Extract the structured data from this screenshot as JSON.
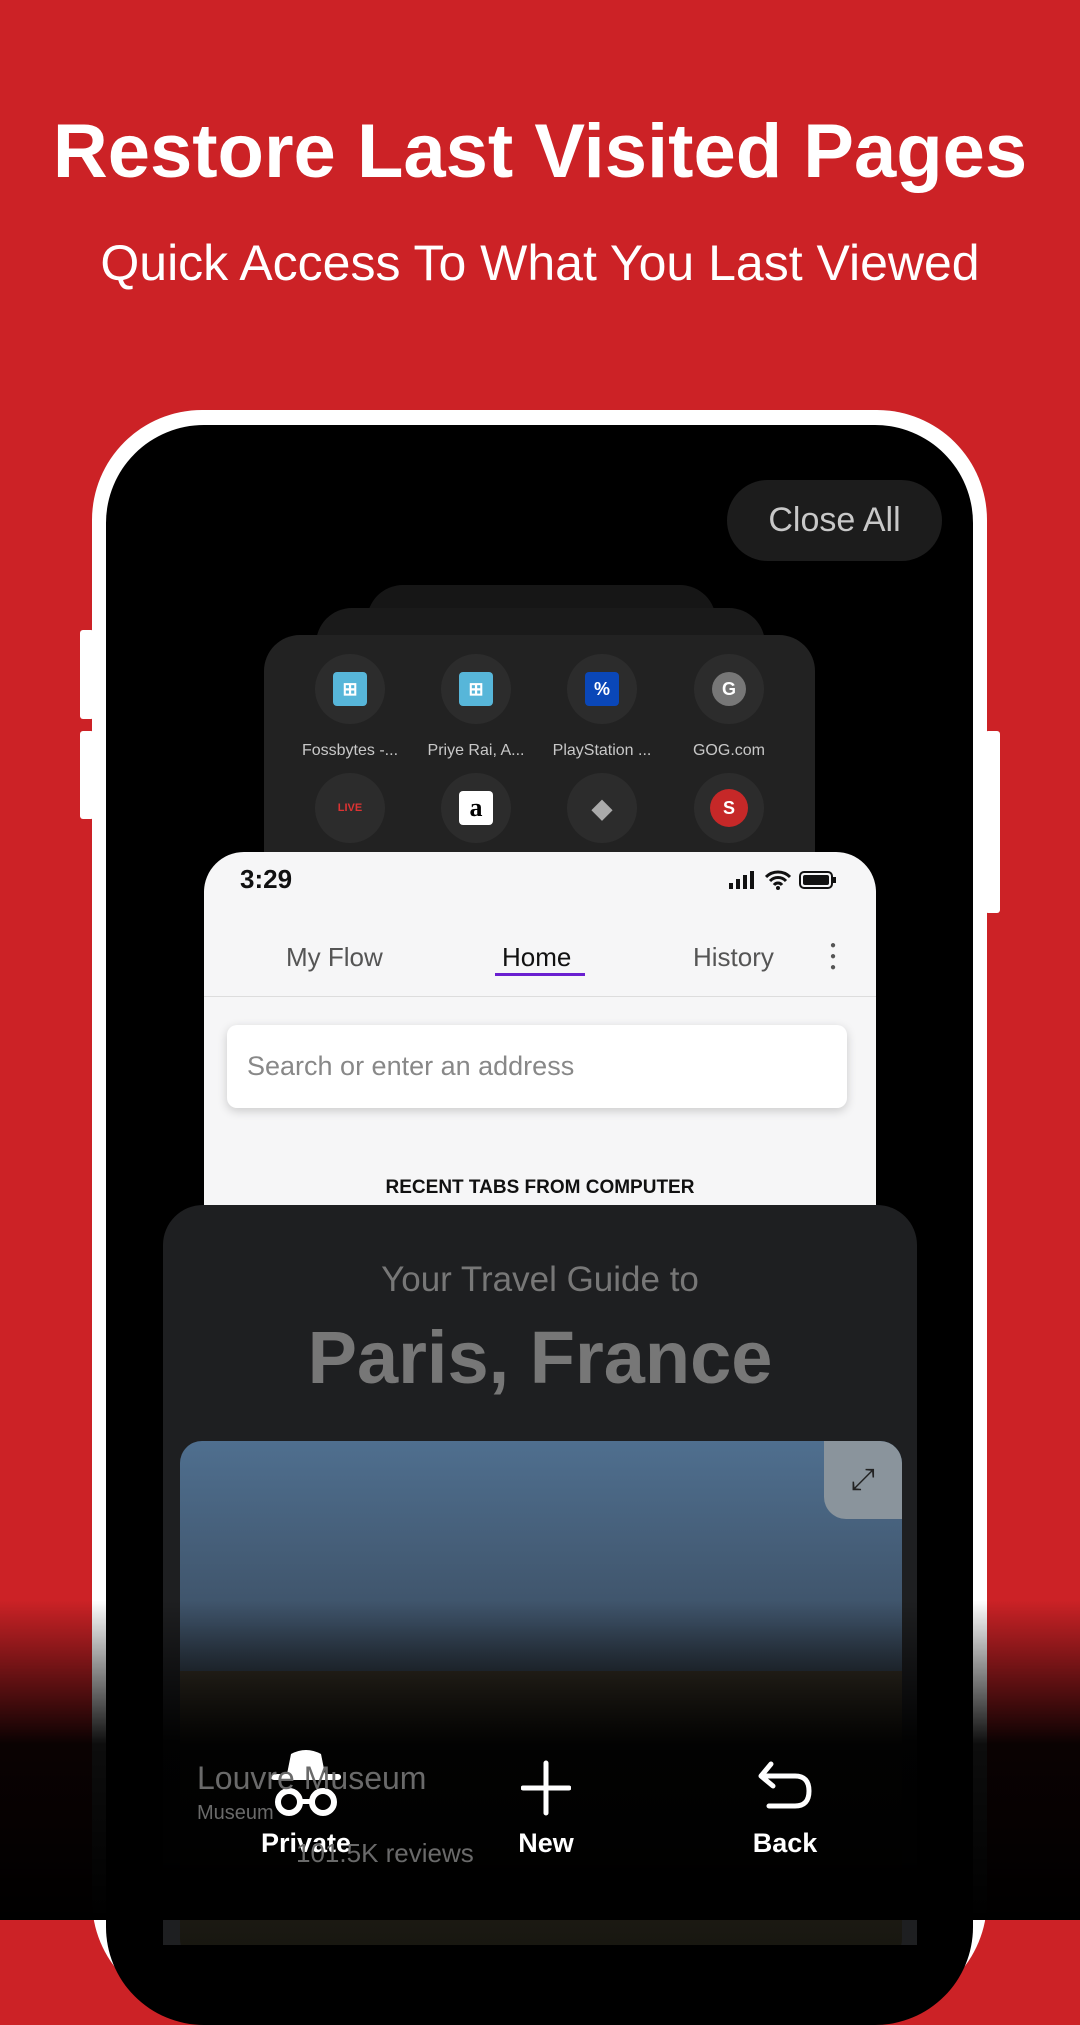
{
  "header": {
    "title": "Restore Last Visited Pages",
    "subtitle": "Quick Access To What You Last Viewed"
  },
  "switcher": {
    "close_all": "Close All"
  },
  "speed_dial": [
    {
      "label": "Fossbytes -...",
      "icon": "fossbytes-icon"
    },
    {
      "label": "Priye Rai, A...",
      "icon": "fossbytes-icon"
    },
    {
      "label": "PlayStation ...",
      "icon": "playstation-icon"
    },
    {
      "label": "GOG.com",
      "icon": "letter-g-icon"
    },
    {
      "label": "",
      "icon": "live-tv-icon"
    },
    {
      "label": "",
      "icon": "amazon-icon"
    },
    {
      "label": "",
      "icon": "layers-icon"
    },
    {
      "label": "",
      "icon": "letter-s-icon"
    }
  ],
  "browser_tab": {
    "time": "3:29",
    "tabs": [
      {
        "label": "My Flow"
      },
      {
        "label": "Home",
        "active": true
      },
      {
        "label": "History"
      }
    ],
    "search_placeholder": "Search or enter an address",
    "section": "RECENT TABS FROM COMPUTER",
    "accent": "#6a1fd0"
  },
  "travel_tab": {
    "subtitle": "Your Travel Guide to",
    "title": "Paris, France",
    "place": "Louvre Museum",
    "category": "Museum",
    "reviews": "101.5K reviews"
  },
  "bottom_nav": [
    {
      "label": "Private",
      "icon": "incognito-icon"
    },
    {
      "label": "New",
      "icon": "plus-icon"
    },
    {
      "label": "Back",
      "icon": "undo-icon"
    }
  ],
  "colors": {
    "background": "#cc2226"
  }
}
